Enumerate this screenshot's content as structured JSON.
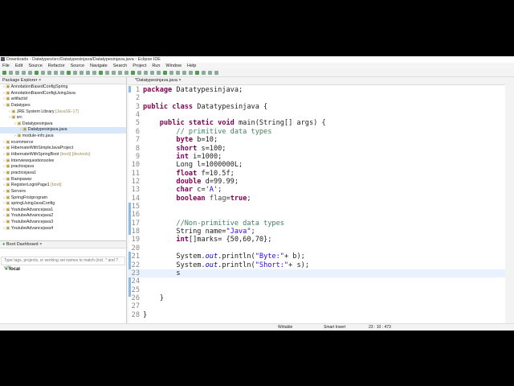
{
  "window": {
    "title": "Downloads - Datatypes/src/Datatypesinjava/Datatypesinjava.java - Eclipse IDE"
  },
  "menu": [
    "File",
    "Edit",
    "Source",
    "Refactor",
    "Source",
    "Navigate",
    "Search",
    "Project",
    "Run",
    "Window",
    "Help"
  ],
  "package_explorer": {
    "title": "Package Explorer",
    "items": [
      {
        "label": "AnnotationBasedConfigSpring",
        "dec": "",
        "indent": 0
      },
      {
        "label": "AnnotationBasedConfigUsingJava",
        "dec": "",
        "indent": 0
      },
      {
        "label": "artifactid",
        "dec": "",
        "indent": 0
      },
      {
        "label": "Datatypes",
        "dec": "",
        "indent": 0
      },
      {
        "label": "JRE System Library",
        "dec": "[JavaSE-17]",
        "indent": 1
      },
      {
        "label": "src",
        "dec": "",
        "indent": 1
      },
      {
        "label": "Datatypesinjava",
        "dec": "",
        "indent": 2
      },
      {
        "label": "Datatypesinjava.java",
        "dec": "",
        "indent": 3,
        "selected": true
      },
      {
        "label": "module-info.java",
        "dec": "",
        "indent": 2
      },
      {
        "label": "ecommerce",
        "dec": "",
        "indent": 0
      },
      {
        "label": "HibernateWithSimpleJavaProject",
        "dec": "",
        "indent": 0
      },
      {
        "label": "HibernateWithSpringBoot",
        "dec": "[boot] [devtools]",
        "indent": 0
      },
      {
        "label": "Interviewquestionsolve",
        "dec": "",
        "indent": 0
      },
      {
        "label": "practicejava",
        "dec": "",
        "indent": 0
      },
      {
        "label": "practicejava1",
        "dec": "",
        "indent": 0
      },
      {
        "label": "Rampawar",
        "dec": "",
        "indent": 0
      },
      {
        "label": "RegisterLoginPage1",
        "dec": "[boot]",
        "indent": 0
      },
      {
        "label": "Servers",
        "dec": "",
        "indent": 0
      },
      {
        "label": "SpringFristprogram",
        "dec": "",
        "indent": 0
      },
      {
        "label": "springUsingJavaConfig",
        "dec": "",
        "indent": 0
      },
      {
        "label": "YoutubeAdvancejava1",
        "dec": "",
        "indent": 0
      },
      {
        "label": "YoutubeAdvancejava2",
        "dec": "",
        "indent": 0
      },
      {
        "label": "YoutubeAdvancejava3",
        "dec": "",
        "indent": 0
      },
      {
        "label": "YoutubeAdvancejava4",
        "dec": "",
        "indent": 0
      }
    ]
  },
  "boot_dashboard": {
    "title": "Boot Dashboard",
    "search_placeholder": "Type tags, projects, or working set names to match (incl. * and ? wild",
    "items": [
      "local"
    ]
  },
  "editor": {
    "tab": "*Datatypesinjava.java",
    "current_line": 23,
    "lines": [
      [
        [
          "package",
          "kw"
        ],
        [
          " Datatypesinjava;",
          ""
        ]
      ],
      [],
      [
        [
          "public class",
          "kw"
        ],
        [
          " Datatypesinjava {",
          ""
        ]
      ],
      [],
      [
        [
          "    public static void",
          "kw"
        ],
        [
          " main(String[] args) {",
          ""
        ]
      ],
      [
        [
          "        // primitive data types",
          "cm"
        ]
      ],
      [
        [
          "        byte",
          "kw"
        ],
        [
          " b=10;",
          ""
        ]
      ],
      [
        [
          "        short",
          "kw"
        ],
        [
          " s=100;",
          ""
        ]
      ],
      [
        [
          "        int",
          "kw"
        ],
        [
          " i=1000;",
          ""
        ]
      ],
      [
        [
          "        Long l=1000000L;",
          ""
        ]
      ],
      [
        [
          "        float",
          "kw"
        ],
        [
          " f=10.5f;",
          ""
        ]
      ],
      [
        [
          "        double",
          "kw"
        ],
        [
          " d=99.99;",
          ""
        ]
      ],
      [
        [
          "        char",
          "kw"
        ],
        [
          " c=",
          ""
        ],
        [
          "'A'",
          "st"
        ],
        [
          ";",
          ""
        ]
      ],
      [
        [
          "        boolean",
          "kw"
        ],
        [
          " ",
          ""
        ],
        [
          "flag",
          "un"
        ],
        [
          "=",
          ""
        ],
        [
          "true",
          "kw"
        ],
        [
          ";",
          ""
        ]
      ],
      [],
      [],
      [
        [
          "        //Non-primitive data types",
          "cm"
        ]
      ],
      [
        [
          "        String name=",
          ""
        ],
        [
          "\"Java\"",
          "st"
        ],
        [
          ";",
          ""
        ]
      ],
      [
        [
          "        int",
          "kw"
        ],
        [
          "[]marks= {50,60,70};",
          ""
        ]
      ],
      [],
      [
        [
          "        System.",
          ""
        ],
        [
          "out",
          "fd"
        ],
        [
          ".println(",
          ""
        ],
        [
          "\"Byte:\"",
          "st"
        ],
        [
          "+ b);",
          ""
        ]
      ],
      [
        [
          "        System.",
          ""
        ],
        [
          "out",
          "fd"
        ],
        [
          ".println(",
          ""
        ],
        [
          "\"Short:\"",
          "st"
        ],
        [
          "+ s);",
          ""
        ]
      ],
      [
        [
          "        s",
          ""
        ]
      ],
      [],
      [],
      [
        [
          "    }",
          ""
        ]
      ],
      [],
      [
        [
          "}",
          ""
        ]
      ]
    ]
  },
  "status": {
    "writable": "Writable",
    "insert_mode": "Smart Insert",
    "position": "23 : 10 : 473"
  }
}
